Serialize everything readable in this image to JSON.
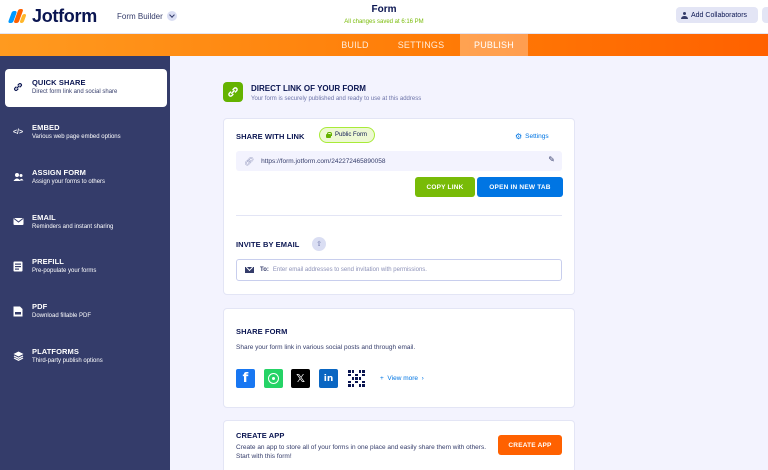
{
  "header": {
    "logo_text": "Jotform",
    "builder_label": "Form Builder",
    "form_title": "Form",
    "saved_status": "All changes saved at 6:16 PM",
    "collab_label": "Add Collaborators"
  },
  "nav": {
    "tabs": [
      {
        "label": "BUILD"
      },
      {
        "label": "SETTINGS"
      },
      {
        "label": "PUBLISH"
      }
    ],
    "active": "PUBLISH",
    "gradient_colors": [
      "#ff9a1f",
      "#ff6100"
    ]
  },
  "sidebar": {
    "items": [
      {
        "title": "QUICK SHARE",
        "subtitle": "Direct form link and social share",
        "icon": "link-icon",
        "active": true
      },
      {
        "title": "EMBED",
        "subtitle": "Various web page embed options",
        "icon": "code-icon"
      },
      {
        "title": "ASSIGN FORM",
        "subtitle": "Assign your forms to others",
        "icon": "users-icon"
      },
      {
        "title": "EMAIL",
        "subtitle": "Reminders and instant sharing",
        "icon": "envelope-icon"
      },
      {
        "title": "PREFILL",
        "subtitle": "Pre-populate your forms",
        "icon": "prefill-icon"
      },
      {
        "title": "PDF",
        "subtitle": "Download fillable PDF",
        "icon": "pdf-icon"
      },
      {
        "title": "PLATFORMS",
        "subtitle": "Third-party publish options",
        "icon": "layers-icon"
      }
    ],
    "bg_color": "#343c6a"
  },
  "main": {
    "direct_link": {
      "title": "DIRECT LINK OF YOUR FORM",
      "subtitle": "Your form is securely published and ready to use at this address"
    },
    "share_link": {
      "label": "SHARE WITH LINK",
      "badge": "Public Form",
      "settings": "Settings",
      "url": "https://form.jotform.com/242272465890058",
      "copy_button": "COPY LINK",
      "open_button": "OPEN IN NEW TAB"
    },
    "invite": {
      "label": "INVITE BY EMAIL",
      "to_label": "To:",
      "placeholder": "Enter email addresses to send invitation with permissions."
    },
    "share_form": {
      "title": "SHARE FORM",
      "description": "Share your form link in various social posts and through email.",
      "socials": [
        "facebook-icon",
        "whatsapp-icon",
        "x-icon",
        "linkedin-icon",
        "qr-code-icon"
      ],
      "view_more": "View more"
    },
    "create_app": {
      "title": "CREATE APP",
      "description": "Create an app to store all of your forms in one place and easily share them with others. Start with this form!",
      "button": "CREATE APP"
    }
  },
  "colors": {
    "green": "#78bb07",
    "blue": "#0075e3",
    "orange": "#ff6100",
    "navy": "#0a1551"
  }
}
